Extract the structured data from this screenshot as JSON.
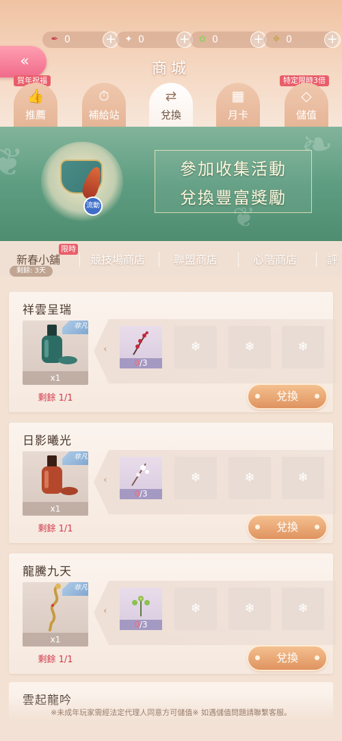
{
  "currencies": [
    {
      "icon": "red-quill-icon",
      "glyph": "✒",
      "color": "#c8404b",
      "value": "0"
    },
    {
      "icon": "star-cluster-icon",
      "glyph": "✦",
      "color": "#ffffff",
      "value": "0"
    },
    {
      "icon": "green-leaf-icon",
      "glyph": "✿",
      "color": "#9ccc65",
      "value": "0"
    },
    {
      "icon": "gold-gem-icon",
      "glyph": "❖",
      "color": "#c9a45a",
      "value": "0"
    }
  ],
  "plus_label": "+",
  "back_label": "«",
  "header": {
    "title": "商城"
  },
  "badges": {
    "newyear": "賀年祝福",
    "limited": "特定限時3倍"
  },
  "tabs": [
    {
      "label": "推薦",
      "glyph": "👍"
    },
    {
      "label": "補給站",
      "glyph": "⏱"
    },
    {
      "label": "兌換",
      "glyph": "⇄"
    },
    {
      "label": "月卡",
      "glyph": "▦"
    },
    {
      "label": "儲值",
      "glyph": "◇"
    }
  ],
  "banner": {
    "line1": "參加收集活動",
    "line2": "兌換豐富獎勵",
    "coin": "流動"
  },
  "subtabs": {
    "items": [
      "新春小舖",
      "競技場商店",
      "聯盟商店",
      "心階商店",
      "評"
    ],
    "limited": "限時",
    "remain": "剩餘: 3天"
  },
  "cards": [
    {
      "title": "祥雲呈瑞",
      "qty": "x1",
      "remain": "剩餘 1/1",
      "badge": "非凡",
      "have": "0",
      "need": "/3",
      "button": "兌換",
      "empty_glyph": "❄",
      "reward": "green-nail-polish-icon",
      "material": "red-plum-branch-icon"
    },
    {
      "title": "日影曦光",
      "qty": "x1",
      "remain": "剩餘 1/1",
      "badge": "非凡",
      "have": "0",
      "need": "/3",
      "button": "兌換",
      "empty_glyph": "❄",
      "reward": "orange-nail-polish-icon",
      "material": "white-blossom-branch-icon"
    },
    {
      "title": "龍騰九天",
      "qty": "x1",
      "remain": "剩餘 1/1",
      "badge": "非凡",
      "have": "0",
      "need": "/3",
      "button": "兌換",
      "empty_glyph": "❄",
      "reward": "gold-dragon-hairpin-icon",
      "material": "green-flower-sprig-icon"
    }
  ],
  "card4_title": "雲起龍吟",
  "footer": "※未成年玩家需經法定代理人同意方可儲值※ 如遇儲值問題請聯繫客服。"
}
